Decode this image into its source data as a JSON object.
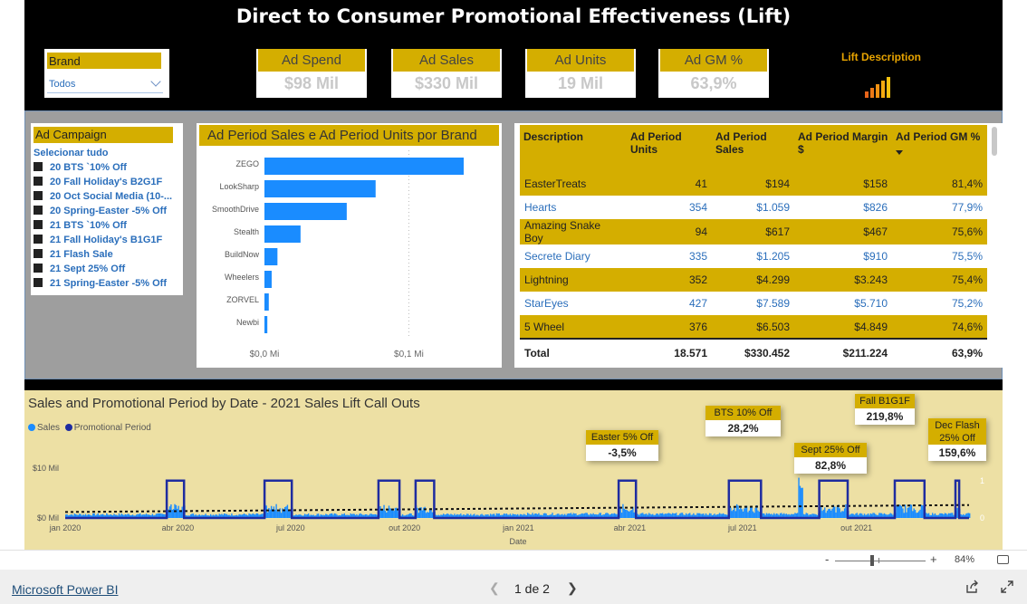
{
  "report": {
    "title": "Direct to Consumer Promotional Effectiveness (Lift)",
    "brand_slicer": {
      "header": "Brand",
      "selected": "Todos"
    },
    "kpis": [
      {
        "label": "Ad Spend",
        "value": "$98 Mil"
      },
      {
        "label": "Ad Sales",
        "value": "$330 Mil"
      },
      {
        "label": "Ad Units",
        "value": "19 Mil"
      },
      {
        "label": "Ad GM %",
        "value": "63,9%"
      }
    ],
    "lift_description": {
      "label": "Lift Description",
      "icon": "bar-chart-icon"
    },
    "campaign_slicer": {
      "header": "Ad Campaign",
      "items": [
        "Selecionar tudo",
        "20 BTS `10% Off",
        "20 Fall Holiday's B2G1F",
        "20 Oct Social Media (10-...",
        "20 Spring-Easter -5% Off",
        "21 BTS `10% Off",
        "21 Fall Holiday's B1G1F",
        "21 Flash Sale",
        "21 Sept 25% Off",
        "21 Spring-Easter -5% Off"
      ]
    },
    "table": {
      "columns": [
        "Description",
        "Ad Period Units",
        "Ad Period Sales",
        "Ad Period Margin $",
        "Ad Period GM %"
      ],
      "rows": [
        [
          "EasterTreats",
          "41",
          "$194",
          "$158",
          "81,4%"
        ],
        [
          "Hearts",
          "354",
          "$1.059",
          "$826",
          "77,9%"
        ],
        [
          "Amazing Snake Boy",
          "94",
          "$617",
          "$467",
          "75,6%"
        ],
        [
          "Secrete Diary",
          "335",
          "$1.205",
          "$910",
          "75,5%"
        ],
        [
          "Lightning",
          "352",
          "$4.299",
          "$3.243",
          "75,4%"
        ],
        [
          "StarEyes",
          "427",
          "$7.589",
          "$5.710",
          "75,2%"
        ],
        [
          "5 Wheel",
          "376",
          "$6.503",
          "$4.849",
          "74,6%"
        ]
      ],
      "total": [
        "Total",
        "18.571",
        "$330.452",
        "$211.224",
        "63,9%"
      ]
    },
    "timeline": {
      "callouts": [
        {
          "label": "Easter 5% Off",
          "value": "-3,5%"
        },
        {
          "label": "BTS 10% Off",
          "value": "28,2%"
        },
        {
          "label": "Fall B1G1F",
          "value": "219,8%"
        },
        {
          "label": "Sept 25% Off",
          "value": "82,8%"
        },
        {
          "label": "Dec Flash 25% Off",
          "value": "159,6%"
        }
      ]
    }
  },
  "chart_data": [
    {
      "type": "bar",
      "orientation": "horizontal",
      "title": "Ad Period Sales e Ad Period Units por Brand",
      "categories": [
        "ZEGO",
        "LookSharp",
        "SmoothDrive",
        "Stealth",
        "BuildNow",
        "Wheelers",
        "ZORVEL",
        "Newbi"
      ],
      "values": [
        0.138,
        0.077,
        0.057,
        0.025,
        0.009,
        0.005,
        0.003,
        0.002
      ],
      "x_ticks": [
        "$0,0 Mi",
        "$0,1 Mi"
      ],
      "xlim": [
        0,
        0.138
      ],
      "color": "#1a8cff"
    },
    {
      "type": "area",
      "title": "Sales and Promotional Period by Date - 2021 Sales Lift Call Outs",
      "xlabel": "Date",
      "legend": [
        "Sales",
        "Promotional Period"
      ],
      "legend_placement": "top-left",
      "y_ticks": [
        "$0 Mil",
        "$10 Mil"
      ],
      "ylim": [
        0,
        10
      ],
      "y2_ticks": [
        "0",
        "1"
      ],
      "x_ticks": [
        "jan 2020",
        "abr 2020",
        "jul 2020",
        "out 2020",
        "jan 2021",
        "abr 2021",
        "jul 2021",
        "out 2021"
      ],
      "x_range": [
        "2020-01-01",
        "2021-12-31"
      ],
      "promotional_periods": [
        [
          "2020-03-23",
          "2020-04-06"
        ],
        [
          "2020-06-10",
          "2020-07-02"
        ],
        [
          "2020-09-10",
          "2020-09-27"
        ],
        [
          "2020-10-10",
          "2020-10-25"
        ],
        [
          "2021-03-23",
          "2021-04-06"
        ],
        [
          "2021-06-20",
          "2021-07-16"
        ],
        [
          "2021-09-01",
          "2021-09-24"
        ],
        [
          "2021-11-01",
          "2021-11-25"
        ],
        [
          "2021-12-20",
          "2021-12-23"
        ]
      ],
      "sales_colors": {
        "sales": "#1a8cff",
        "promotional_period": "#1e2ca0"
      }
    }
  ]
}
